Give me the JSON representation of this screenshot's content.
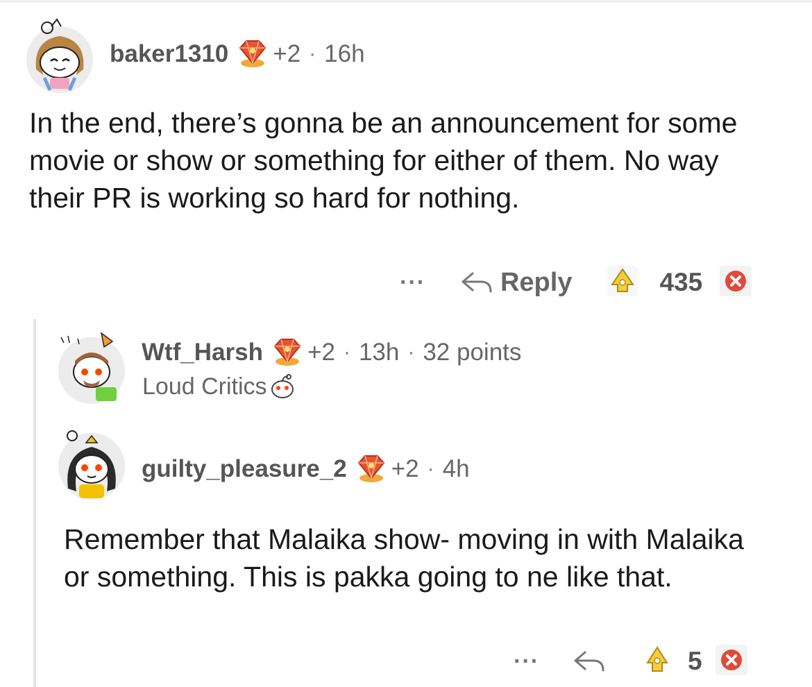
{
  "comments": [
    {
      "username": "baker1310",
      "award_count": "+2",
      "time": "16h",
      "body": "In the end, there’s gonna be an announcement for some movie or show or something for either of them. No way their PR is working so hard for nothing.",
      "actions": {
        "more": "···",
        "reply": "Reply",
        "score": "435"
      }
    },
    {
      "username": "Wtf_Harsh",
      "award_count": "+2",
      "time": "13h",
      "points": "32 points",
      "flair": "Loud Critics"
    },
    {
      "username": "guilty_pleasure_2",
      "award_count": "+2",
      "time": "4h",
      "body": "Remember that Malaika show- moving in with Malaika or something. This is pakka going to ne like that.",
      "actions": {
        "more": "···",
        "score": "5"
      }
    }
  ],
  "separators": {
    "dot": "·"
  },
  "icons": {
    "avatar": "snoo-avatar-icon",
    "award": "gem-award-icon",
    "reply": "reply-arrow-icon",
    "upvote": "upvote-icon",
    "downvote": "downvote-icon"
  },
  "colors": {
    "text": "#1a1a1b",
    "muted": "#666666",
    "downvote": "#e04a3a",
    "upvote": "#f0c419",
    "thread_line": "#e5e5e5"
  }
}
